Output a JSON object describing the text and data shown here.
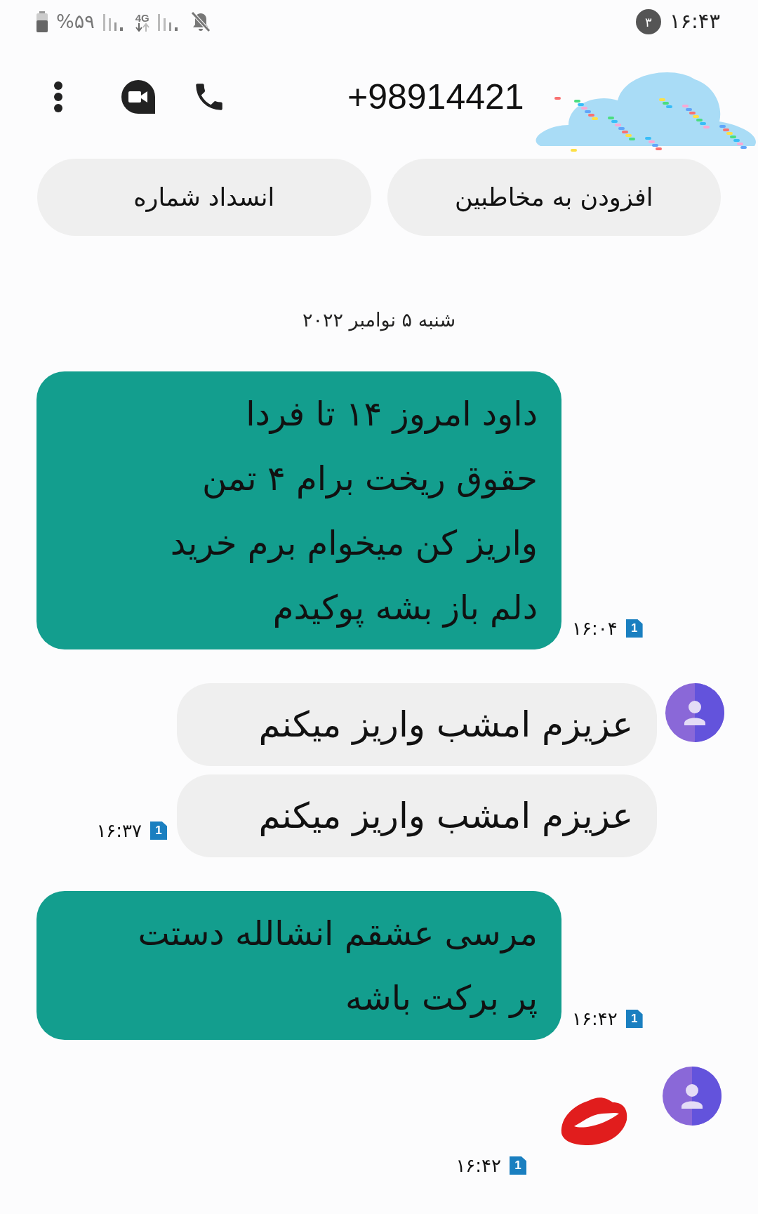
{
  "status_bar": {
    "battery": "%۵۹",
    "network": "4G",
    "notification_count": "۳",
    "time": "۱۶:۴۳"
  },
  "header": {
    "title": "+98914421"
  },
  "actions": [
    {
      "label": "افزودن به مخاطبین"
    },
    {
      "label": "انسداد شماره"
    }
  ],
  "date": "شنبه ۵ نوامبر ۲۰۲۲",
  "conversation": [
    {
      "kind": "incoming",
      "messages": [
        {
          "kind": "text",
          "lines": [
            "داود امروز ۱۴ تا فردا",
            "حقوق ریخت برام ۴ تمن",
            "واریز کن میخوام برم خرید",
            "دلم باز بشه پوکیدم"
          ]
        }
      ],
      "time": "۱۶:۰۴",
      "sim": "1"
    },
    {
      "kind": "outgoing",
      "messages": [
        {
          "kind": "text",
          "lines": [
            "عزیزم امشب واریز میکنم"
          ]
        },
        {
          "kind": "text",
          "lines": [
            "عزیزم امشب واریز میکنم"
          ]
        }
      ],
      "time": "۱۶:۳۷",
      "sim": "1"
    },
    {
      "kind": "incoming",
      "messages": [
        {
          "kind": "text",
          "lines": [
            "مرسی عشقم انشالله دستت",
            "پر برکت باشه"
          ]
        }
      ],
      "time": "۱۶:۴۲",
      "sim": "1"
    },
    {
      "kind": "outgoing",
      "messages": [
        {
          "kind": "sticker"
        }
      ],
      "time": "۱۶:۴۲",
      "sim": "1"
    }
  ]
}
